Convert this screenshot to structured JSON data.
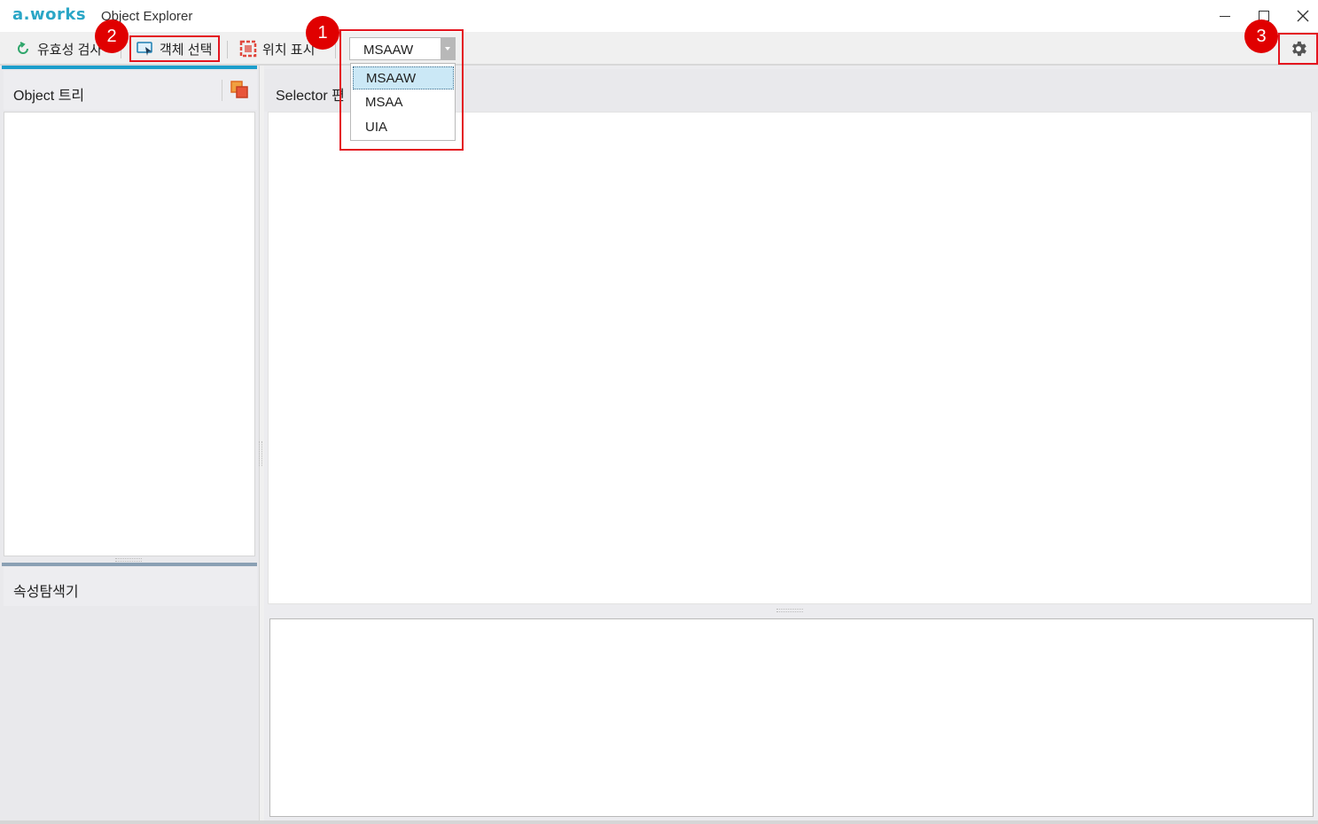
{
  "window": {
    "brand": "a.works",
    "title": "Object Explorer"
  },
  "toolbar": {
    "validate_label": "유효성 검사",
    "select_label": "객체 선택",
    "location_label": "위치 표시",
    "engine_value": "MSAAW"
  },
  "engine_dropdown": {
    "options": [
      "MSAAW",
      "MSAA",
      "UIA"
    ],
    "selected": "MSAAW"
  },
  "panels": {
    "tree_title": "Object 트리",
    "properties_title": "속성탐색기",
    "selector_title": "Selector 편"
  },
  "annotations": {
    "badge1": "1",
    "badge2": "2",
    "badge3": "3"
  },
  "colors": {
    "brand": "#2aa6c6",
    "accent": "#1c9ecb",
    "highlight": "#e4151f",
    "badge": "#e00000"
  }
}
